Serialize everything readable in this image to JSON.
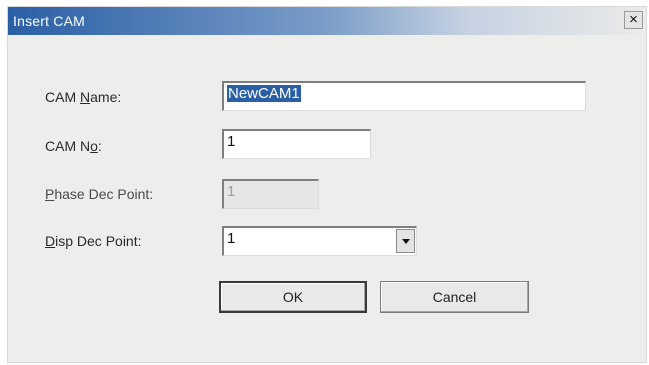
{
  "dialog": {
    "title": "Insert CAM",
    "close_glyph": "×"
  },
  "fields": {
    "cam_name": {
      "label_pre": "CAM ",
      "label_key": "N",
      "label_post": "ame:",
      "value": "NewCAM1"
    },
    "cam_no": {
      "label_pre": "CAM N",
      "label_key": "o",
      "label_post": ":",
      "value": "1"
    },
    "phase_dec_point": {
      "label_pre": "",
      "label_key": "P",
      "label_post": "hase Dec Point:",
      "value": "1"
    },
    "disp_dec_point": {
      "label_pre": "",
      "label_key": "D",
      "label_post": "isp Dec Point:",
      "value": "1"
    }
  },
  "buttons": {
    "ok": "OK",
    "cancel": "Cancel"
  }
}
